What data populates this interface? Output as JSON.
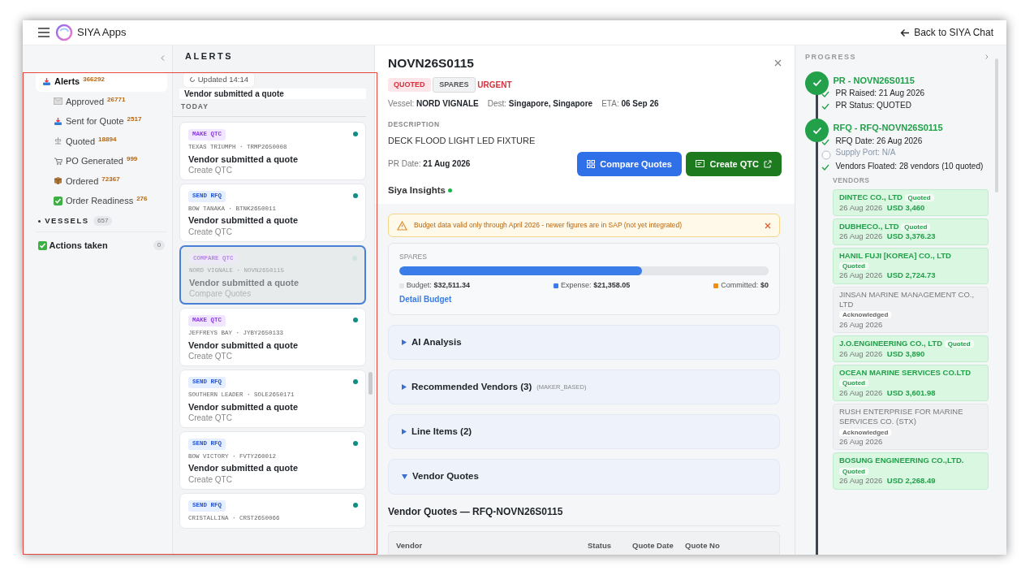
{
  "app": {
    "title": "SIYA Apps",
    "back_link": "Back to SIYA Chat"
  },
  "sidebar": {
    "items": [
      {
        "label": "Alerts",
        "count": "366292",
        "selected": true
      },
      {
        "label": "Approved",
        "count": "26771",
        "selected": false
      },
      {
        "label": "Sent for Quote",
        "count": "2517",
        "selected": false
      },
      {
        "label": "Quoted",
        "count": "18894",
        "selected": false
      },
      {
        "label": "PO Generated",
        "count": "999",
        "selected": false
      },
      {
        "label": "Ordered",
        "count": "72367",
        "selected": false
      },
      {
        "label": "Order Readiness",
        "count": "276",
        "selected": false
      }
    ],
    "vessels": {
      "label": "VESSELS",
      "count": "657"
    },
    "actions": {
      "label": "Actions taken",
      "count": "0"
    }
  },
  "alerts": {
    "title": "ALERTS",
    "updated": "Updated 14:14",
    "peek_title": "Vendor submitted a quote",
    "group": "TODAY",
    "cards": [
      {
        "tag": "MAKE QTC",
        "kind": "make",
        "meta": "TEXAS TRIUMPH · TRMP2650008",
        "title": "Vendor submitted a quote",
        "action": "Create QTC",
        "unread": true,
        "selected": false
      },
      {
        "tag": "SEND RFQ",
        "kind": "send",
        "meta": "BOW TANAKA · BTNK2650011",
        "title": "Vendor submitted a quote",
        "action": "Create QTC",
        "unread": true,
        "selected": false
      },
      {
        "tag": "COMPARE QTC",
        "kind": "make",
        "meta": "NORD VIGNALE · NOVN2650115",
        "title": "Vendor submitted a quote",
        "action": "Compare Quotes",
        "unread": false,
        "selected": true
      },
      {
        "tag": "MAKE QTC",
        "kind": "make",
        "meta": "JEFFREYS BAY · JYBY2650133",
        "title": "Vendor submitted a quote",
        "action": "Create QTC",
        "unread": true,
        "selected": false
      },
      {
        "tag": "SEND RFQ",
        "kind": "send",
        "meta": "SOUTHERN LEADER · SOLE2650171",
        "title": "Vendor submitted a quote",
        "action": "Create QTC",
        "unread": true,
        "selected": false
      },
      {
        "tag": "SEND RFQ",
        "kind": "send",
        "meta": "BOW VICTORY · FVTY260012",
        "title": "Vendor submitted a quote",
        "action": "Create QTC",
        "unread": true,
        "selected": false
      },
      {
        "tag": "SEND RFQ",
        "kind": "send",
        "meta": "CRISTALLINA · CRST2650066",
        "unread": true,
        "selected": false
      }
    ]
  },
  "detail": {
    "title": "NOVN26S0115",
    "status": "QUOTED",
    "category": "SPARES",
    "priority": "URGENT",
    "facts": [
      {
        "label": "Vessel:",
        "value": "NORD VIGNALE"
      },
      {
        "label": "Dest:",
        "value": "Singapore, Singapore"
      },
      {
        "label": "ETA:",
        "value": "06 Sep 26"
      }
    ],
    "description_label": "DESCRIPTION",
    "description": "DECK FLOOD LIGHT LED FIXTURE",
    "pr_date": {
      "label": "PR Date:",
      "value": "21 Aug 2026"
    },
    "buttons": [
      {
        "label": "Compare Quotes",
        "kind": "primary"
      },
      {
        "label": "Create QTC",
        "kind": "success"
      }
    ],
    "insights_title": "Siya Insights",
    "warning": "Budget data valid only through April 2026 - newer figures are in SAP (not yet integrated)",
    "budget": {
      "title": "SPARES",
      "level": 0.657,
      "budget": {
        "label": "Budget:",
        "value": "$32,511.34"
      },
      "expense": {
        "label": "Expense:",
        "value": "$21,358.05"
      },
      "committed": {
        "label": "Committed:",
        "value": "$0"
      },
      "link": "Detail Budget"
    },
    "sections": [
      {
        "title": "AI Analysis",
        "expanded": false
      },
      {
        "title": "Recommended Vendors (3)",
        "note": "(MAKER_BASED)",
        "expanded": false
      },
      {
        "title": "Line Items (2)",
        "expanded": false
      },
      {
        "title": "Vendor Quotes",
        "expanded": true
      }
    ],
    "quotes_title": "Vendor Quotes — RFQ-NOVN26S0115",
    "table": {
      "columns": [
        "Vendor",
        "Status",
        "Quote Date",
        "Quote No"
      ]
    }
  },
  "progress": {
    "title": "PROGRESS",
    "stages": [
      {
        "title": "PR - NOVN26S0115",
        "done": true,
        "steps": [
          {
            "text": "PR Raised: 21 Aug 2026",
            "done": true
          },
          {
            "text": "PR Status: QUOTED",
            "done": true
          }
        ]
      },
      {
        "title": "RFQ - RFQ-NOVN26S0115",
        "done": true,
        "steps": [
          {
            "text": "RFQ Date: 26 Aug 2026",
            "done": true
          },
          {
            "text": "Supply Port: N/A",
            "done": false
          },
          {
            "text": "Vendors Floated: 28 vendors (10 quoted)",
            "done": true
          }
        ]
      }
    ],
    "vendors_label": "VENDORS",
    "vendors": [
      {
        "name": "DINTEC CO., LTD",
        "status": "Quoted",
        "kind": "quoted",
        "date": "26 Aug 2026",
        "amount": "USD 3,460"
      },
      {
        "name": "DUBHECO., LTD",
        "status": "Quoted",
        "kind": "quoted",
        "date": "26 Aug 2026",
        "amount": "USD 3,376.23"
      },
      {
        "name": "HANIL FUJI [KOREA] CO., LTD",
        "status": "Quoted",
        "kind": "quoted",
        "date": "26 Aug 2026",
        "amount": "USD 2,724.73"
      },
      {
        "name": "JINSAN MARINE MANAGEMENT CO., LTD",
        "status": "Acknowledged",
        "kind": "ack",
        "date": "26 Aug 2026"
      },
      {
        "name": "J.O.ENGINEERING CO., LTD",
        "status": "Quoted",
        "kind": "quoted",
        "date": "26 Aug 2026",
        "amount": "USD 3,890"
      },
      {
        "name": "OCEAN MARINE SERVICES CO.LTD",
        "status": "Quoted",
        "kind": "quoted",
        "date": "26 Aug 2026",
        "amount": "USD 3,601.98"
      },
      {
        "name": "RUSH ENTERPRISE FOR MARINE SERVICES CO. (STX)",
        "status": "Acknowledged",
        "kind": "ack",
        "date": "26 Aug 2026"
      },
      {
        "name": "BOSUNG ENGINEERING CO.,LTD.",
        "status": "Quoted",
        "kind": "quoted",
        "date": "26 Aug 2026",
        "amount": "USD 2,268.49"
      }
    ]
  }
}
